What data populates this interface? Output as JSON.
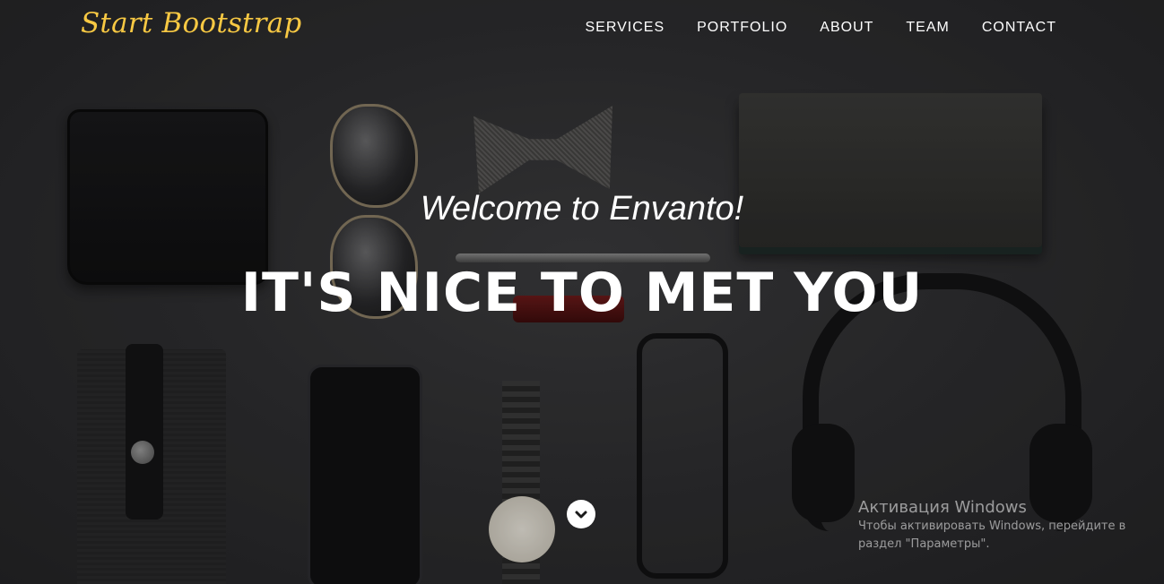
{
  "navbar": {
    "brand": "Start Bootstrap",
    "items": [
      {
        "label": "SERVICES"
      },
      {
        "label": "PORTFOLIO"
      },
      {
        "label": "ABOUT"
      },
      {
        "label": "TEAM"
      },
      {
        "label": "CONTACT"
      }
    ]
  },
  "hero": {
    "lead": "Welcome to Envanto!",
    "heading": "IT'S NICE TO MET YOU",
    "scroll_icon": "chevron-down-icon"
  },
  "watermark": {
    "title": "Активация Windows",
    "line1": "Чтобы активировать Windows, перейдите в",
    "line2": "раздел \"Параметры\"."
  },
  "colors": {
    "brand": "#f7c843",
    "nav_text": "#ffffff",
    "hero_text": "#ffffff",
    "background": "#2b2b2d"
  }
}
